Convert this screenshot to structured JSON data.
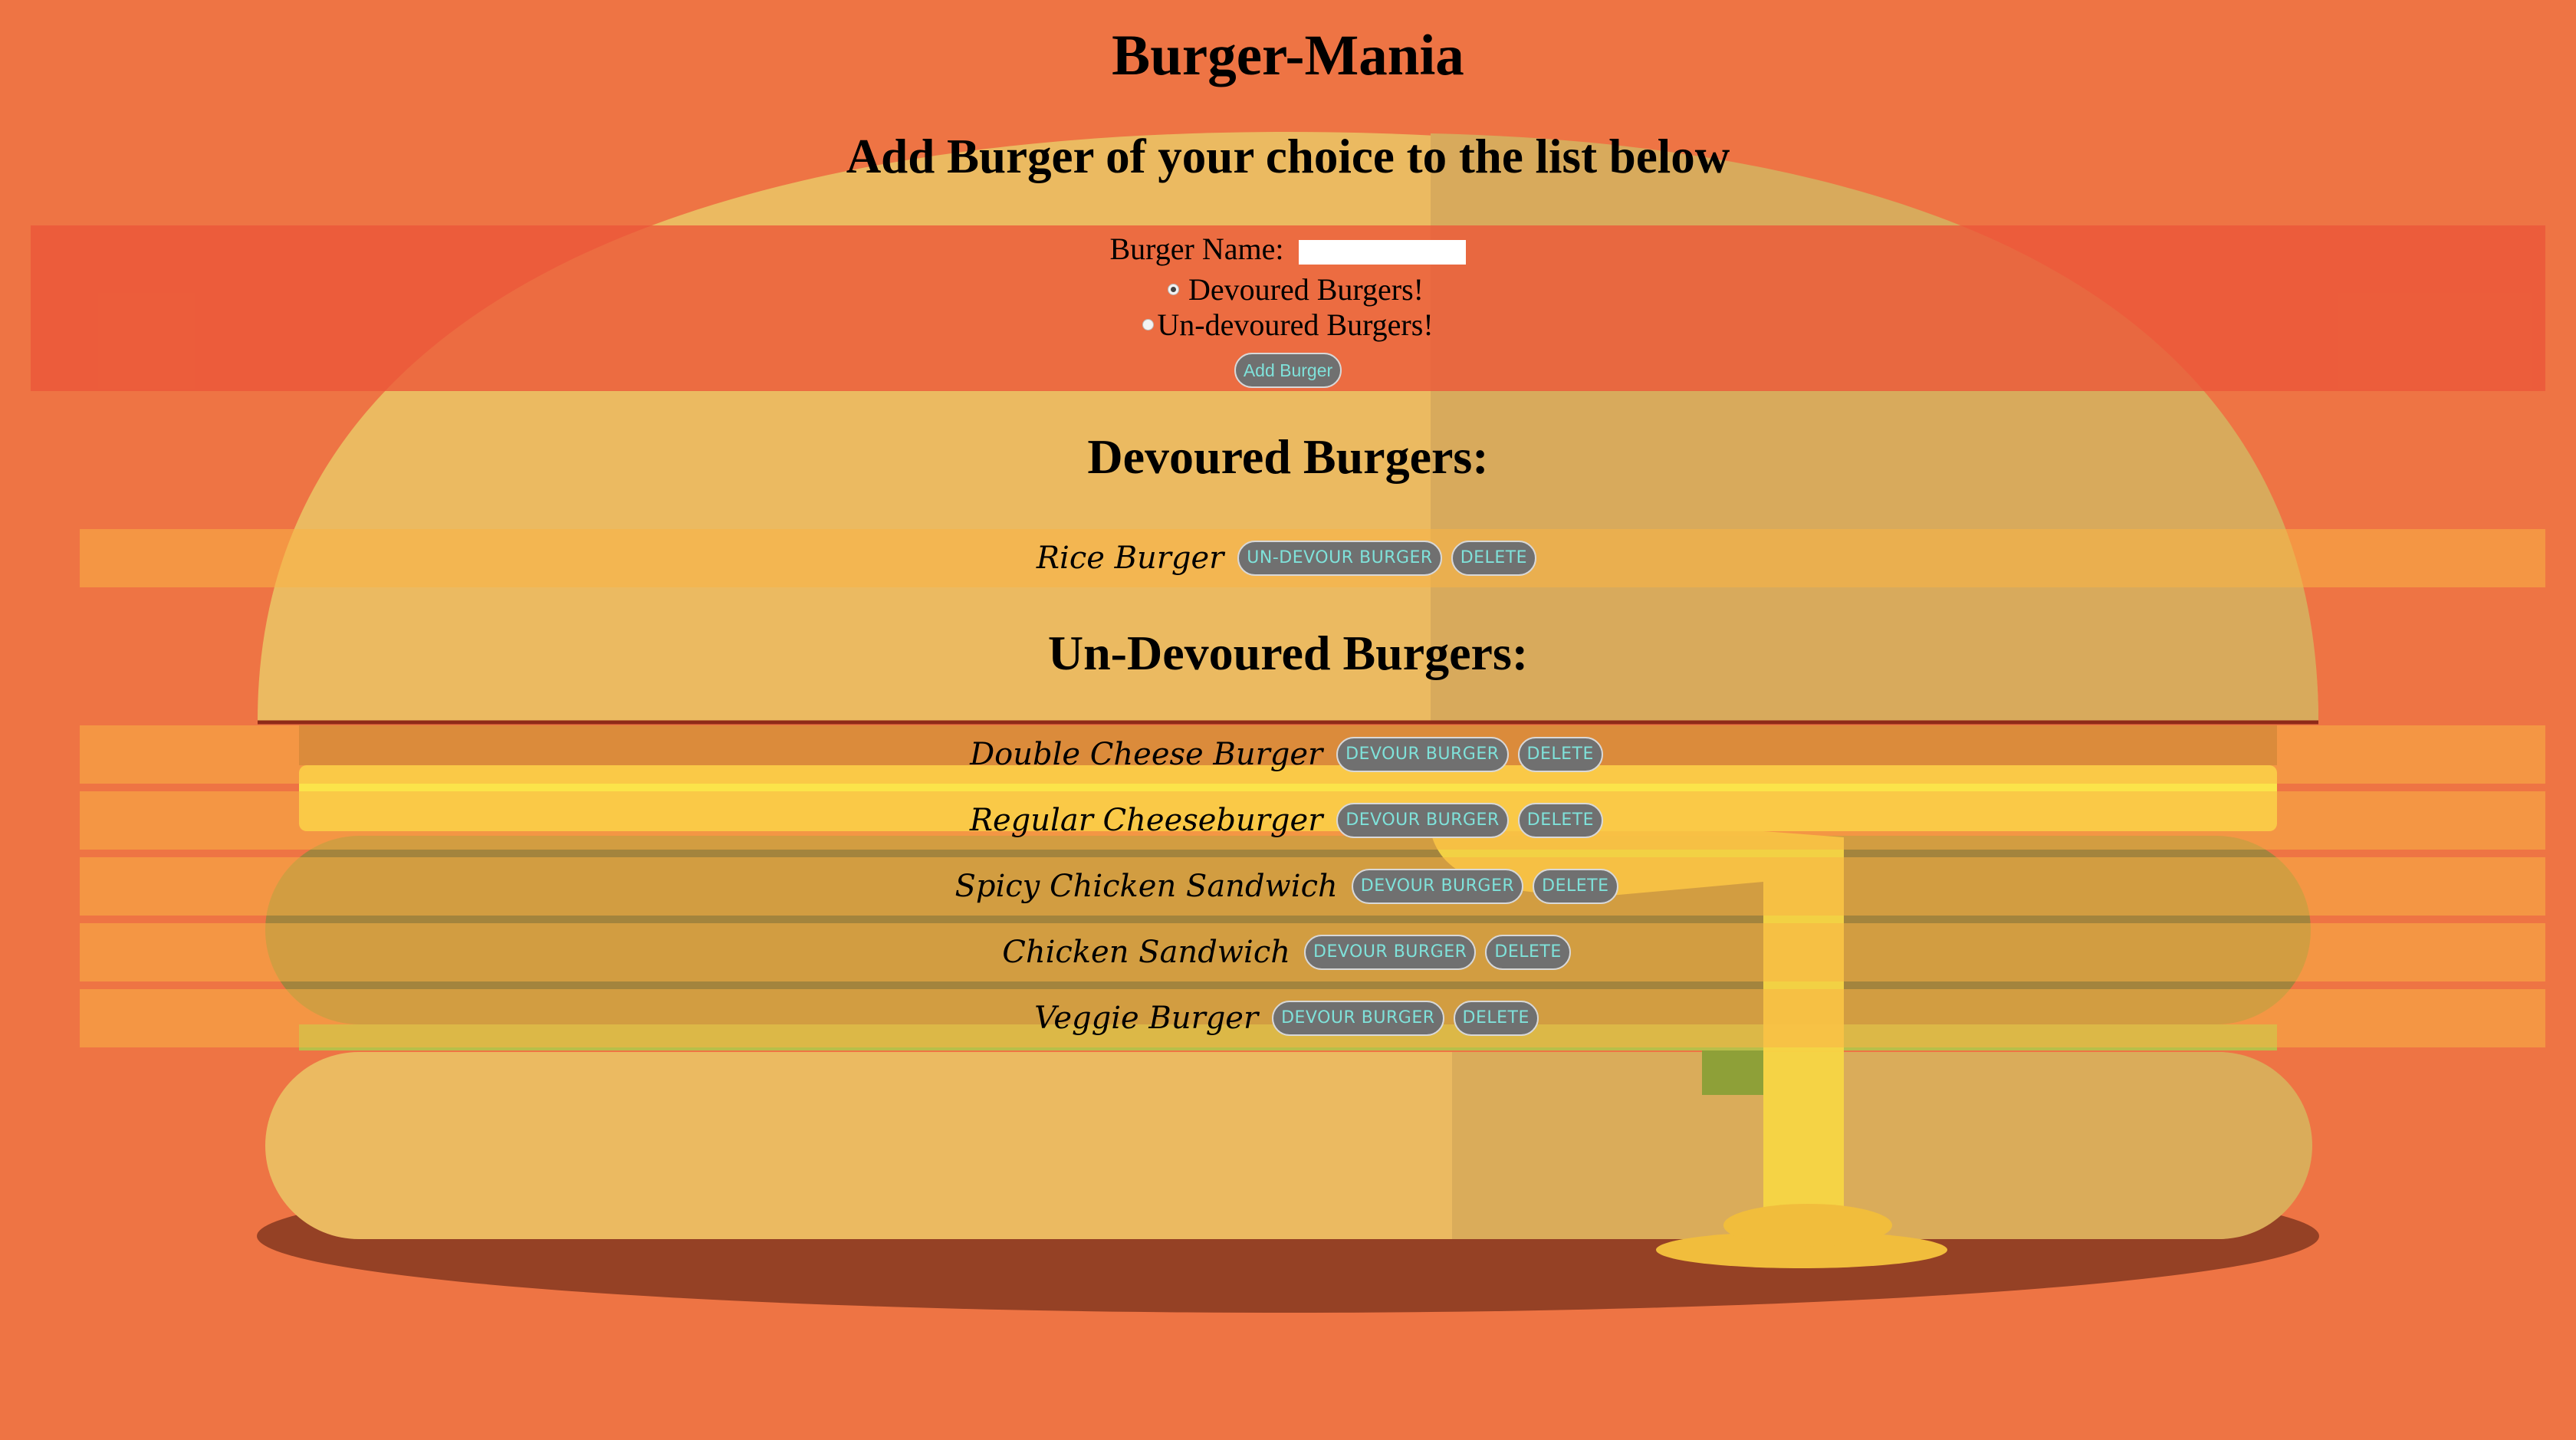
{
  "header": {
    "title": "Burger-Mania",
    "subtitle": "Add Burger of your choice to the list below"
  },
  "form": {
    "name_label": "Burger Name:",
    "name_value": "",
    "radio_devoured_label": "Devoured Burgers!",
    "radio_devoured_checked": true,
    "radio_undevoured_label": "Un-devoured Burgers!",
    "radio_undevoured_checked": false,
    "submit_label": "Add Burger"
  },
  "devoured": {
    "heading": "Devoured Burgers:",
    "items": [
      {
        "name": "Rice Burger",
        "action_label": "UN-DEVOUR BURGER",
        "delete_label": "DELETE"
      }
    ]
  },
  "undevoured": {
    "heading": "Un-Devoured Burgers:",
    "items": [
      {
        "name": "Double Cheese Burger",
        "action_label": "DEVOUR BURGER",
        "delete_label": "DELETE"
      },
      {
        "name": "Regular Cheeseburger",
        "action_label": "DEVOUR BURGER",
        "delete_label": "DELETE"
      },
      {
        "name": "Spicy Chicken Sandwich",
        "action_label": "DEVOUR BURGER",
        "delete_label": "DELETE"
      },
      {
        "name": "Chicken Sandwich",
        "action_label": "DEVOUR BURGER",
        "delete_label": "DELETE"
      },
      {
        "name": "Veggie Burger",
        "action_label": "DEVOUR BURGER",
        "delete_label": "DELETE"
      }
    ]
  },
  "colors": {
    "background": "#ee7444",
    "form_band": "#ec5638",
    "row_band": "#fab246",
    "button_bg": "#707070",
    "button_text": "#7fe2da"
  },
  "background_art": "burger-illustration"
}
